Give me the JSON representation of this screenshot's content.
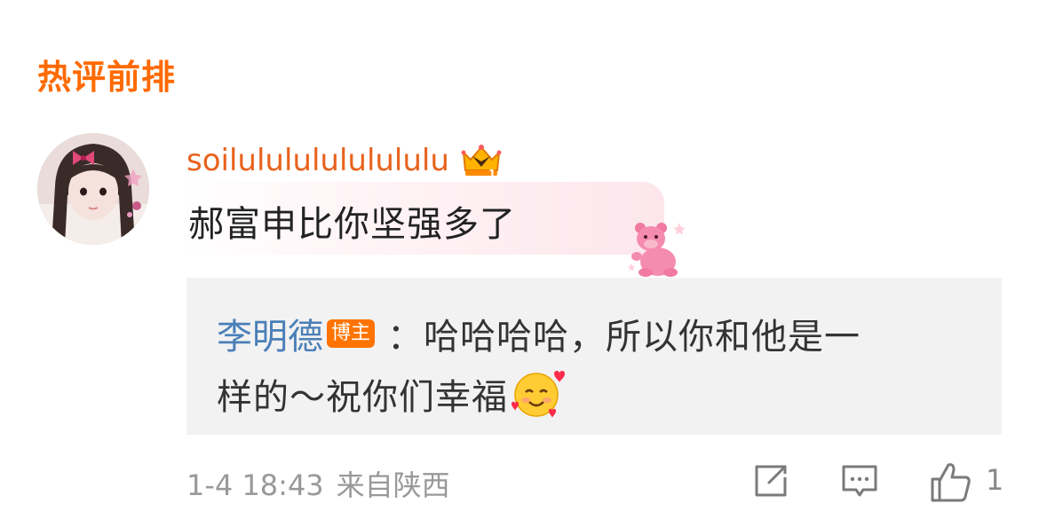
{
  "section": {
    "title": "热评前排"
  },
  "comment": {
    "username": "soilulululululululu",
    "badge_icon": "crown-badge-icon",
    "text": "郝富申比你坚强多了",
    "sticker": "lotso-bear-sticker",
    "reply": {
      "author": "李明德",
      "author_tag": "博主",
      "text_line1": "：哈哈哈哈，所以你和他是一",
      "text_line2": "样的～祝你们幸福",
      "emoji": "smiling-face-with-hearts"
    },
    "date": "1-4 18:43",
    "location": "来自陕西",
    "actions": {
      "share_icon": "share-icon",
      "comment_icon": "comment-icon",
      "like_icon": "like-icon",
      "like_count": "1"
    }
  },
  "colors": {
    "accent": "#ff6a00",
    "username": "#e8621c",
    "reply_author": "#4a7fb8",
    "meta_gray": "#999999",
    "reply_bg": "#f2f2f2"
  }
}
